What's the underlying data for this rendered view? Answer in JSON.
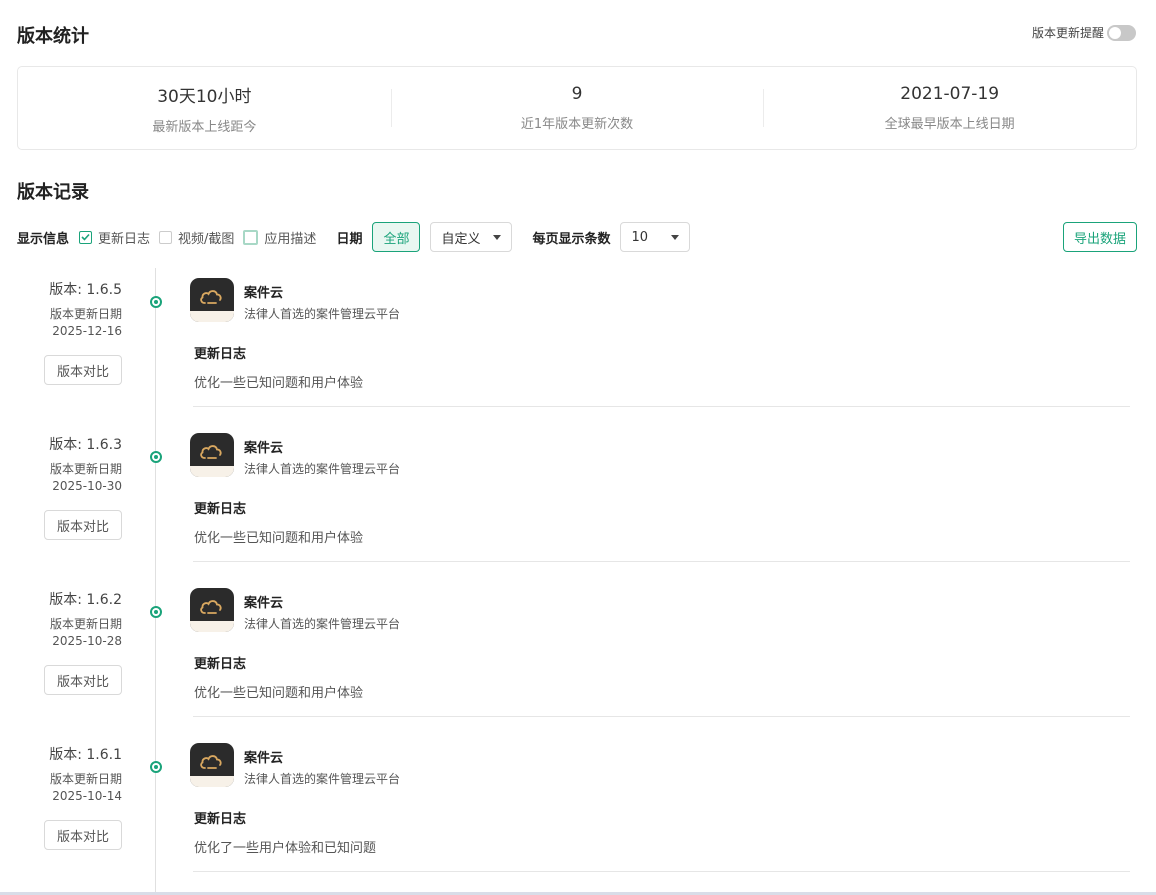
{
  "colors": {
    "accent": "#1aa37a",
    "icon_bg": "#2b2b2b"
  },
  "stats_section": {
    "title": "版本统计",
    "reminder_label": "版本更新提醒",
    "reminder_on": false,
    "items": [
      {
        "value": "30天10小时",
        "label": "最新版本上线距今"
      },
      {
        "value": "9",
        "label": "近1年版本更新次数"
      },
      {
        "value": "2021-07-19",
        "label": "全球最早版本上线日期"
      }
    ]
  },
  "records_section": {
    "title": "版本记录",
    "filters": {
      "display_label": "显示信息",
      "options": [
        {
          "label": "更新日志",
          "checked": true
        },
        {
          "label": "视频/截图",
          "checked": false
        },
        {
          "label": "应用描述",
          "checked": false
        }
      ],
      "date_label": "日期",
      "date_all": "全部",
      "date_custom": "自定义",
      "per_page_label": "每页显示条数",
      "per_page_value": "10",
      "export_label": "导出数据"
    },
    "entries": [
      {
        "version": "版本: 1.6.5",
        "date_label": "版本更新日期",
        "date": "2025-12-16",
        "compare": "版本对比",
        "app_name": "案件云",
        "app_sub": "法律人首选的案件管理云平台",
        "log_title": "更新日志",
        "log_text": "优化一些已知问题和用户体验"
      },
      {
        "version": "版本: 1.6.3",
        "date_label": "版本更新日期",
        "date": "2025-10-30",
        "compare": "版本对比",
        "app_name": "案件云",
        "app_sub": "法律人首选的案件管理云平台",
        "log_title": "更新日志",
        "log_text": "优化一些已知问题和用户体验"
      },
      {
        "version": "版本: 1.6.2",
        "date_label": "版本更新日期",
        "date": "2025-10-28",
        "compare": "版本对比",
        "app_name": "案件云",
        "app_sub": "法律人首选的案件管理云平台",
        "log_title": "更新日志",
        "log_text": "优化一些已知问题和用户体验"
      },
      {
        "version": "版本: 1.6.1",
        "date_label": "版本更新日期",
        "date": "2025-10-14",
        "compare": "版本对比",
        "app_name": "案件云",
        "app_sub": "法律人首选的案件管理云平台",
        "log_title": "更新日志",
        "log_text": "优化了一些用户体验和已知问题"
      }
    ]
  }
}
